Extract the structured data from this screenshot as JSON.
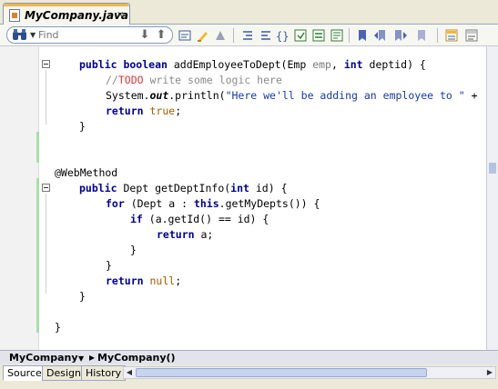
{
  "tab": {
    "title": "MyCompany.java",
    "close": "×"
  },
  "toolbar": {
    "find_placeholder": "Find",
    "icons": [
      "find-previous",
      "find-next",
      "toggle-highlight",
      "toggle-bookmark",
      "shift-left",
      "shift-right",
      "braces",
      "macro-start",
      "macro-stop",
      "comment",
      "uncomment",
      "bookmark",
      "prev-bookmark",
      "next-bookmark",
      "toggle-bookmarks",
      "diff",
      "tasks"
    ]
  },
  "code": {
    "l1": "public boolean addEmployeeToDept(Emp emp, int deptid) {",
    "l2_comment_prefix": "//",
    "l2_todo": "TODO",
    "l2_rest": " write some logic here",
    "l3_prefix": "System.",
    "l3_out": "out",
    "l3_mid": ".println(",
    "l3_string": "\"Here we'll be adding an employee to \"",
    "l3_tail": " +",
    "l4_return": "return",
    "l4_true": "true",
    "l5": "}",
    "l6": "@WebMethod",
    "l7": "public Dept getDeptInfo(int id) {",
    "l8": "for (Dept a : this.getMyDepts()) {",
    "l9": "if (a.getId() == id) {",
    "l10_return": "return",
    "l10_val": "a;",
    "l11": "}",
    "l12": "}",
    "l13_return": "return",
    "l13_null": "null",
    "l14": "}",
    "l15": "}"
  },
  "breadcrumbs": [
    "MyCompany",
    "MyCompany()"
  ],
  "bottom_tabs": [
    "Source",
    "Design",
    "History"
  ]
}
